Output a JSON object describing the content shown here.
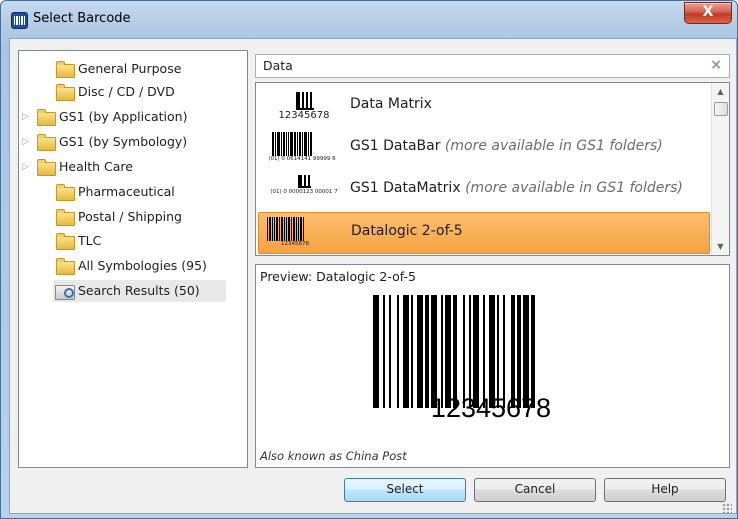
{
  "window": {
    "title": "Select Barcode",
    "close_label": "X"
  },
  "tree": {
    "items": [
      {
        "label": "General Purpose",
        "expandable": false
      },
      {
        "label": "Disc / CD / DVD",
        "expandable": false
      },
      {
        "label": "GS1 (by Application)",
        "expandable": true
      },
      {
        "label": "GS1 (by Symbology)",
        "expandable": true
      },
      {
        "label": "Health Care",
        "expandable": true
      },
      {
        "label": "Pharmaceutical",
        "expandable": false
      },
      {
        "label": "Postal / Shipping",
        "expandable": false
      },
      {
        "label": "TLC",
        "expandable": false
      },
      {
        "label": "All Symbologies (95)",
        "expandable": false
      },
      {
        "label": "Search Results (50)",
        "expandable": false,
        "selected": true
      }
    ]
  },
  "search": {
    "value": "Data",
    "clear_label": "×"
  },
  "results": [
    {
      "name": "Data Matrix",
      "note": "",
      "caption": "12345678"
    },
    {
      "name": "GS1 DataBar",
      "note": "(more available in GS1 folders)",
      "caption": "(01) 0 0614141 99999 6"
    },
    {
      "name": "GS1 DataMatrix",
      "note": "(more available in GS1 folders)",
      "caption": "(01) 0 0000123 00001 7"
    },
    {
      "name": "Datalogic 2-of-5",
      "note": "",
      "caption": "12345678",
      "selected": true
    }
  ],
  "preview": {
    "label": "Preview: Datalogic 2-of-5",
    "digits": "12345678",
    "also_known_as": "Also known as China Post"
  },
  "buttons": {
    "select": "Select",
    "cancel": "Cancel",
    "help": "Help"
  },
  "colors": {
    "selection": "#f6a13e",
    "title_gradient": "#b6cde6",
    "close_red": "#c13a22"
  }
}
